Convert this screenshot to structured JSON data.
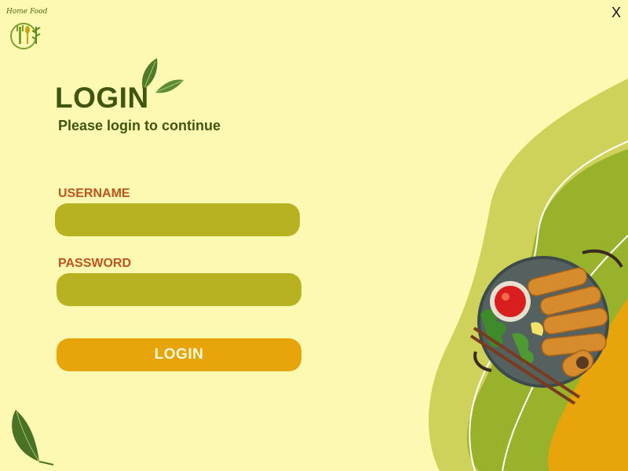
{
  "brand": {
    "logo_text": "Home Food"
  },
  "window": {
    "close_label": "X"
  },
  "login": {
    "title": "LOGIN",
    "subtitle": "Please login to continue",
    "username_label": "USERNAME",
    "username_value": "",
    "password_label": "PASSWORD",
    "password_value": "",
    "button_label": "LOGIN"
  },
  "colors": {
    "background": "#fdf8b2",
    "field": "#b6b221",
    "button": "#e8a40b",
    "label": "#c0531c",
    "title": "#3e5610"
  },
  "icons": [
    "home-food-logo-icon",
    "leaf-icon",
    "spring-rolls-plate-image"
  ]
}
